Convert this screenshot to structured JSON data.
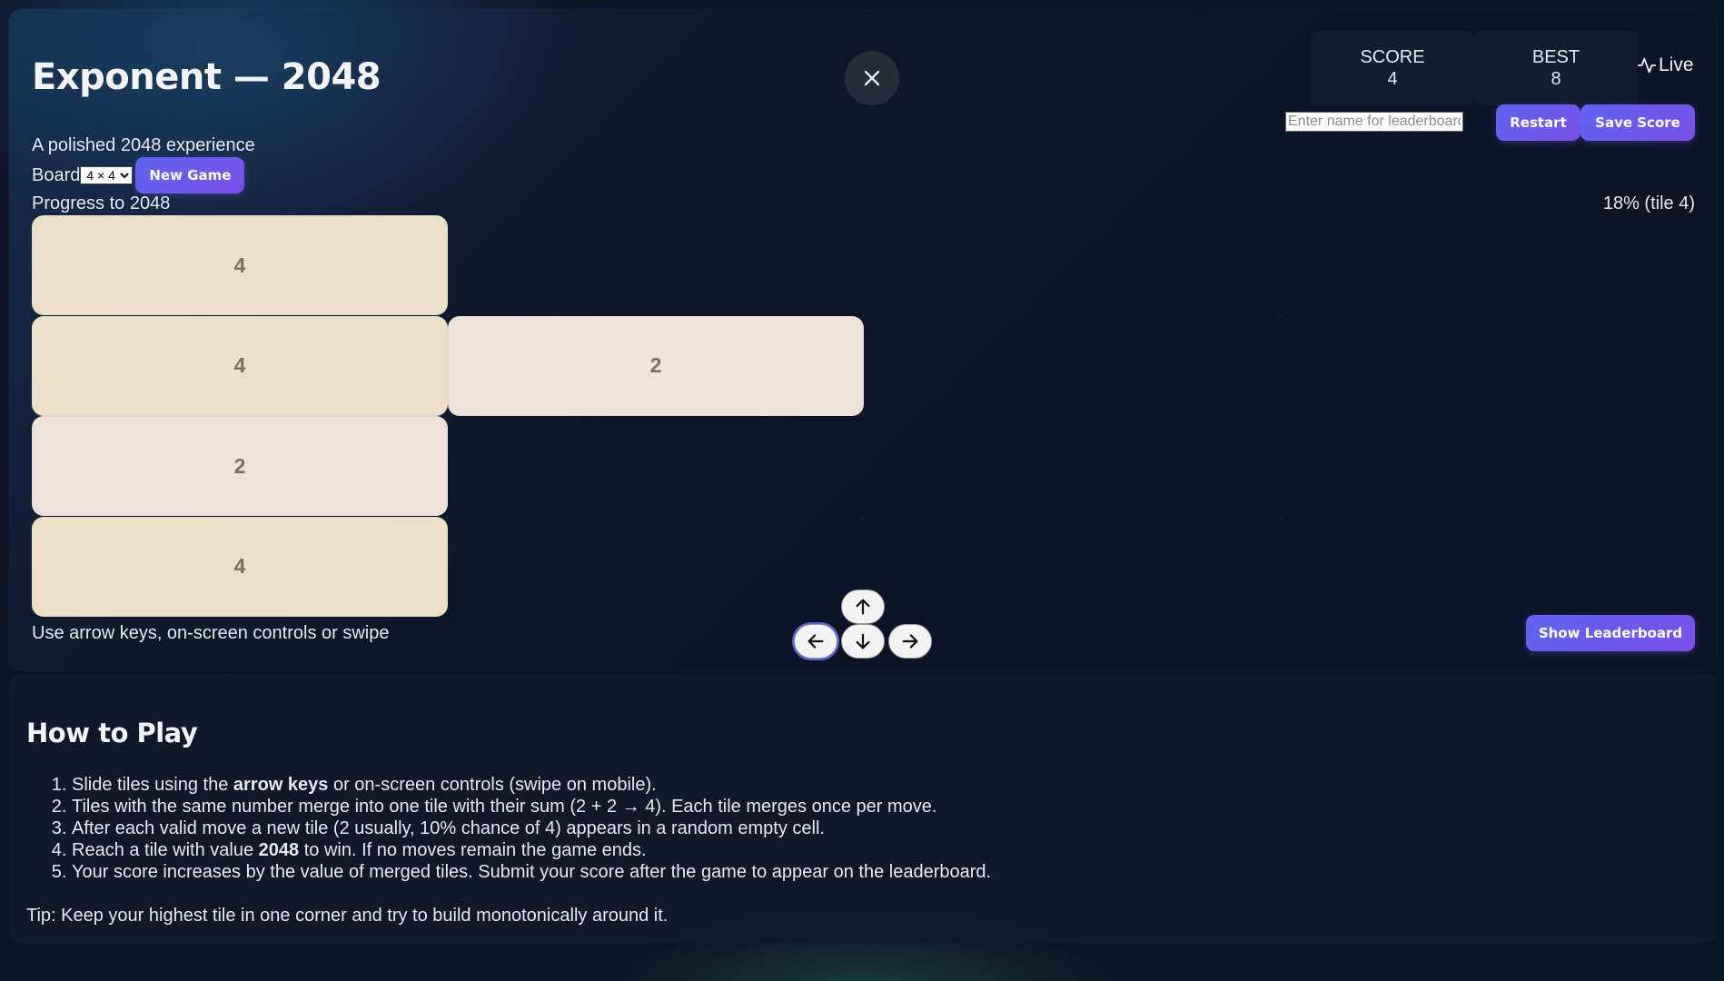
{
  "header": {
    "title": "Exponent — 2048",
    "subtitle": "A polished 2048 experience",
    "board_label": "Board",
    "board_options": [
      "4 × 4"
    ],
    "board_selected": "4 × 4",
    "new_game_label": "New Game",
    "close_icon": "close-icon"
  },
  "stats": {
    "score_label": "SCORE",
    "score_value": "4",
    "best_label": "BEST",
    "best_value": "8",
    "live_label": "Live"
  },
  "leaderboard": {
    "name_placeholder": "Enter name for leaderboard",
    "name_value": "",
    "restart_label": "Restart",
    "save_label": "Save Score",
    "show_label": "Show Leaderboard"
  },
  "progress": {
    "label": "Progress to 2048",
    "value_text": "18% (tile 4)",
    "percent": 18
  },
  "board": {
    "size": 4,
    "tiles": [
      {
        "row": 0,
        "col": 0,
        "value": 4
      },
      {
        "row": 1,
        "col": 0,
        "value": 4
      },
      {
        "row": 1,
        "col": 1,
        "value": 2
      },
      {
        "row": 2,
        "col": 0,
        "value": 2
      },
      {
        "row": 3,
        "col": 0,
        "value": 4
      }
    ],
    "tile_colors": {
      "2": "#eee3da",
      "4": "#ede0c8"
    }
  },
  "controls": {
    "hint": "Use arrow keys, on-screen controls or swipe",
    "icons": [
      "arrow-up-icon",
      "arrow-left-icon",
      "arrow-down-icon",
      "arrow-right-icon"
    ]
  },
  "howto": {
    "title": "How to Play",
    "steps": [
      {
        "pre": "Slide tiles using the ",
        "bold": "arrow keys",
        "post": " or on-screen controls (swipe on mobile)."
      },
      {
        "pre": "Tiles with the same number merge into one tile with their sum (2 + 2 → 4). Each tile merges once per move.",
        "bold": "",
        "post": ""
      },
      {
        "pre": "After each valid move a new tile (2 usually, 10% chance of 4) appears in a random empty cell.",
        "bold": "",
        "post": ""
      },
      {
        "pre": "Reach a tile with value ",
        "bold": "2048",
        "post": " to win. If no moves remain the game ends."
      },
      {
        "pre": "Your score increases by the value of merged tiles. Submit your score after the game to appear on the leaderboard.",
        "bold": "",
        "post": ""
      }
    ],
    "tip": "Tip: Keep your highest tile in one corner and try to build monotonically around it."
  },
  "colors": {
    "accent": "#6a5cf0",
    "background": "#0c1326",
    "tile_text": "#7a6f66"
  }
}
